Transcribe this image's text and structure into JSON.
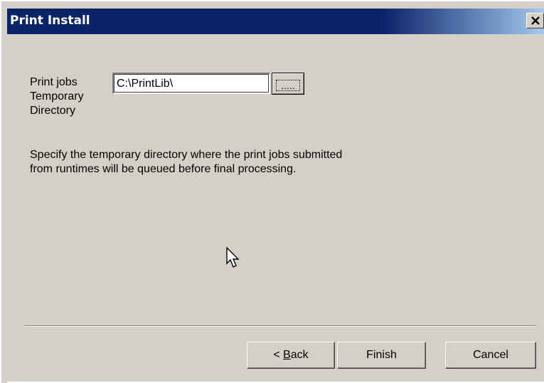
{
  "window": {
    "title": "Print Install",
    "close_glyph": "✕"
  },
  "form": {
    "directory_label": "Print jobs Temporary Directory",
    "directory_value": "C:\\PrintLib\\",
    "browse_label": "....."
  },
  "description": "Specify the temporary directory where the print jobs submitted from runtimes will be queued before final processing.",
  "buttons": {
    "back_prefix": "< ",
    "back_mnemonic": "B",
    "back_rest": "ack",
    "finish": "Finish",
    "cancel": "Cancel"
  },
  "colors": {
    "titlebar": "#0a246a",
    "face": "#d4d0c8"
  }
}
